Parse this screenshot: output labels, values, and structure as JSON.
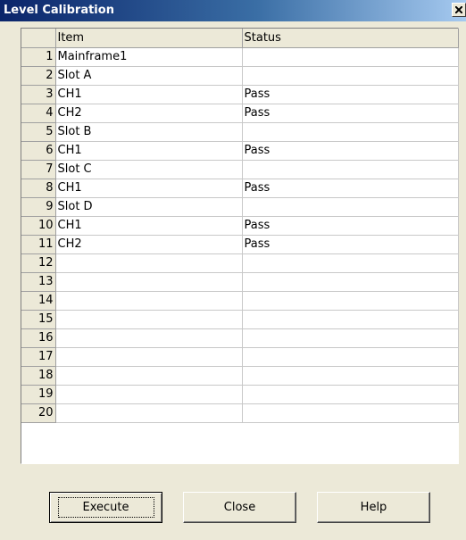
{
  "window": {
    "title": "Level Calibration"
  },
  "grid": {
    "headers": {
      "item": "Item",
      "status": "Status"
    },
    "rows": [
      {
        "num": "1",
        "item": "Mainframe1",
        "status": "",
        "level": 0
      },
      {
        "num": "2",
        "item": "Slot A",
        "status": "",
        "level": 1
      },
      {
        "num": "3",
        "item": "CH1",
        "status": "Pass",
        "level": 2
      },
      {
        "num": "4",
        "item": "CH2",
        "status": "Pass",
        "level": 2
      },
      {
        "num": "5",
        "item": "Slot B",
        "status": "",
        "level": 1
      },
      {
        "num": "6",
        "item": "CH1",
        "status": "Pass",
        "level": 2
      },
      {
        "num": "7",
        "item": "Slot C",
        "status": "",
        "level": 1
      },
      {
        "num": "8",
        "item": "CH1",
        "status": "Pass",
        "level": 2
      },
      {
        "num": "9",
        "item": "Slot D",
        "status": "",
        "level": 1
      },
      {
        "num": "10",
        "item": "CH1",
        "status": "Pass",
        "level": 2
      },
      {
        "num": "11",
        "item": "CH2",
        "status": "Pass",
        "level": 2
      },
      {
        "num": "12",
        "item": "",
        "status": "",
        "level": 0
      },
      {
        "num": "13",
        "item": "",
        "status": "",
        "level": 0
      },
      {
        "num": "14",
        "item": "",
        "status": "",
        "level": 0
      },
      {
        "num": "15",
        "item": "",
        "status": "",
        "level": 0
      },
      {
        "num": "16",
        "item": "",
        "status": "",
        "level": 0
      },
      {
        "num": "17",
        "item": "",
        "status": "",
        "level": 0
      },
      {
        "num": "18",
        "item": "",
        "status": "",
        "level": 0
      },
      {
        "num": "19",
        "item": "",
        "status": "",
        "level": 0
      },
      {
        "num": "20",
        "item": "",
        "status": "",
        "level": 0
      }
    ]
  },
  "buttons": {
    "execute": "Execute",
    "close": "Close",
    "help": "Help"
  }
}
